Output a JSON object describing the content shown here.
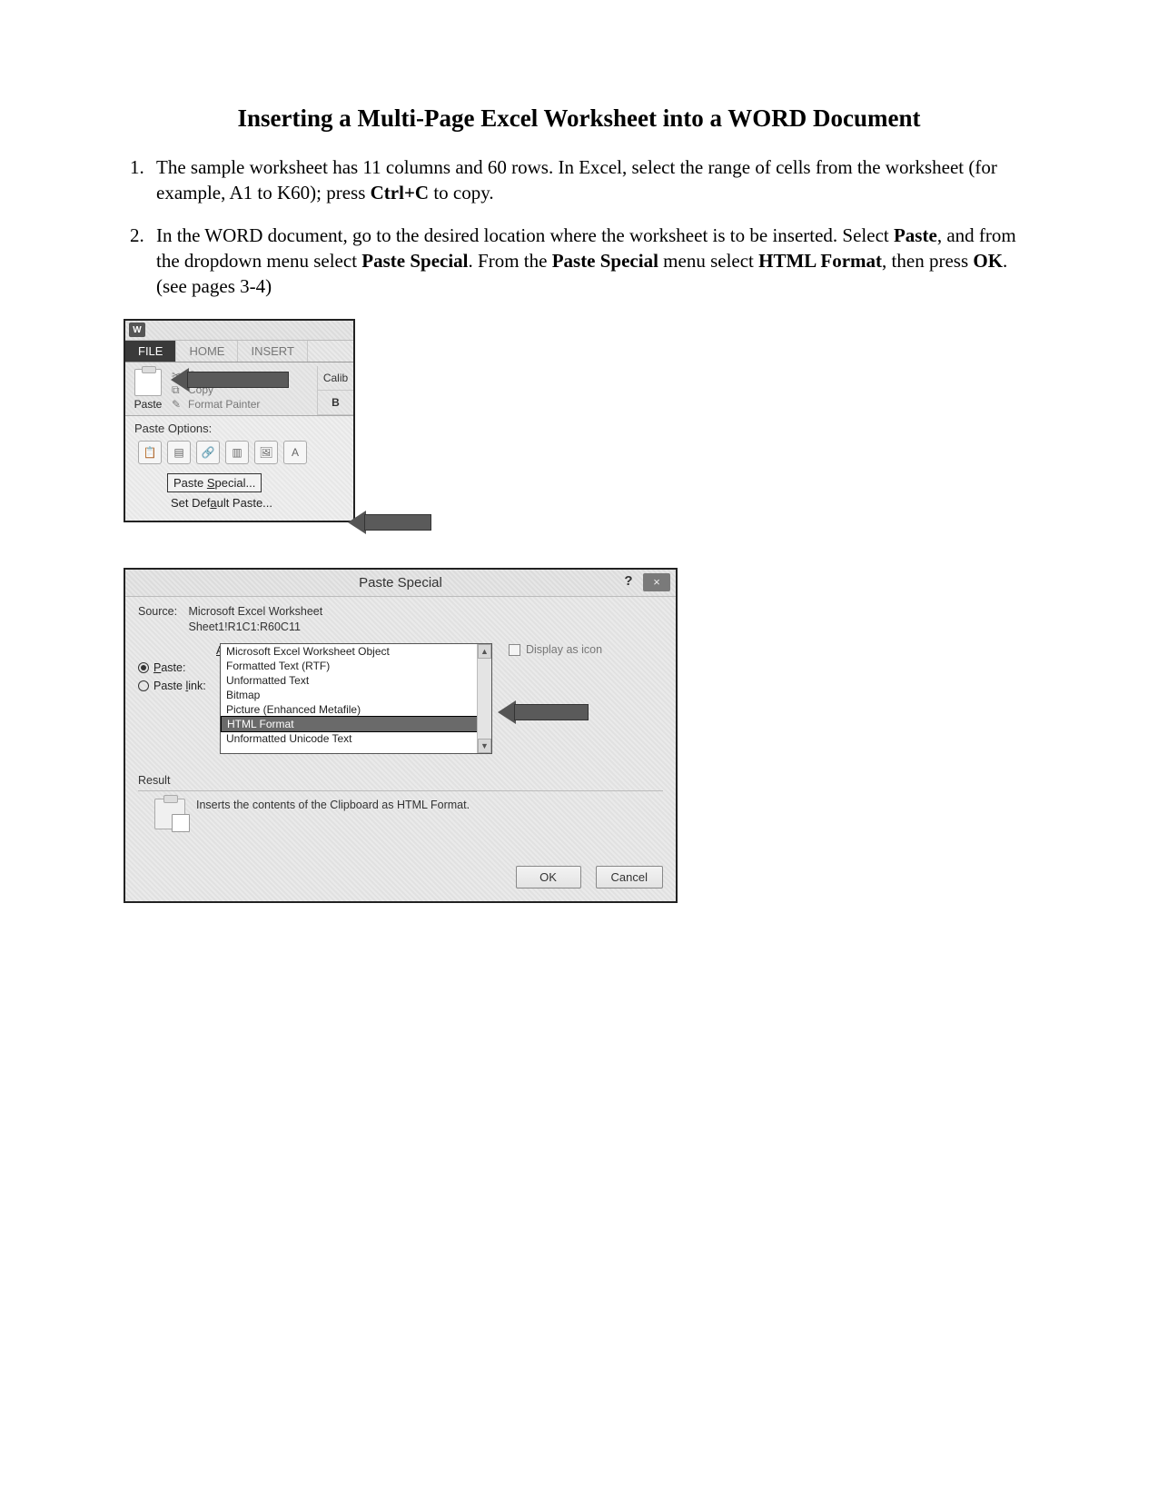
{
  "title": "Inserting a Multi-Page Excel Worksheet into a WORD Document",
  "steps": {
    "s1a": "The sample worksheet has 11 columns and 60 rows. In Excel, select the range of cells from the worksheet (for example, A1 to K60); press ",
    "s1b": "Ctrl+C",
    "s1c": " to copy.",
    "s2a": "In the WORD document, go to the desired location where the worksheet is to be inserted. Select ",
    "s2b": "Paste",
    "s2c": ", and from the dropdown menu select ",
    "s2d": "Paste Special",
    "s2e": ". From the ",
    "s2f": "Paste Special",
    "s2g": " menu select ",
    "s2h": "HTML Format",
    "s2i": ", then press ",
    "s2j": "OK",
    "s2k": ". (see pages 3-4)"
  },
  "ribbon": {
    "word_glyph": "W",
    "tab_file": "FILE",
    "tab_home": "HOME",
    "tab_insert": "INSERT",
    "paste_label": "Paste",
    "cut": "Cut",
    "copy": "Copy",
    "format_painter": "Format Painter",
    "font_name": "Calib",
    "bold": "B",
    "dd_title": "Paste Options:",
    "dd_paste_special": "Paste Special...",
    "dd_set_default": "Set Default Paste..."
  },
  "dialog": {
    "title": "Paste Special",
    "help": "?",
    "close": "×",
    "source_label": "Source:",
    "source_line1": "Microsoft Excel Worksheet",
    "source_line2": "Sheet1!R1C1:R60C11",
    "as_label": "As:",
    "radio_paste": "Paste:",
    "radio_paste_link": "Paste link:",
    "list": {
      "i0": "Microsoft Excel Worksheet Object",
      "i1": "Formatted Text (RTF)",
      "i2": "Unformatted Text",
      "i3": "Bitmap",
      "i4": "Picture (Enhanced Metafile)",
      "i5": "HTML Format",
      "i6": "Unformatted Unicode Text"
    },
    "display_as_icon": "Display as icon",
    "result_label": "Result",
    "result_text": "Inserts the contents of the Clipboard as HTML Format.",
    "ok": "OK",
    "cancel": "Cancel"
  }
}
